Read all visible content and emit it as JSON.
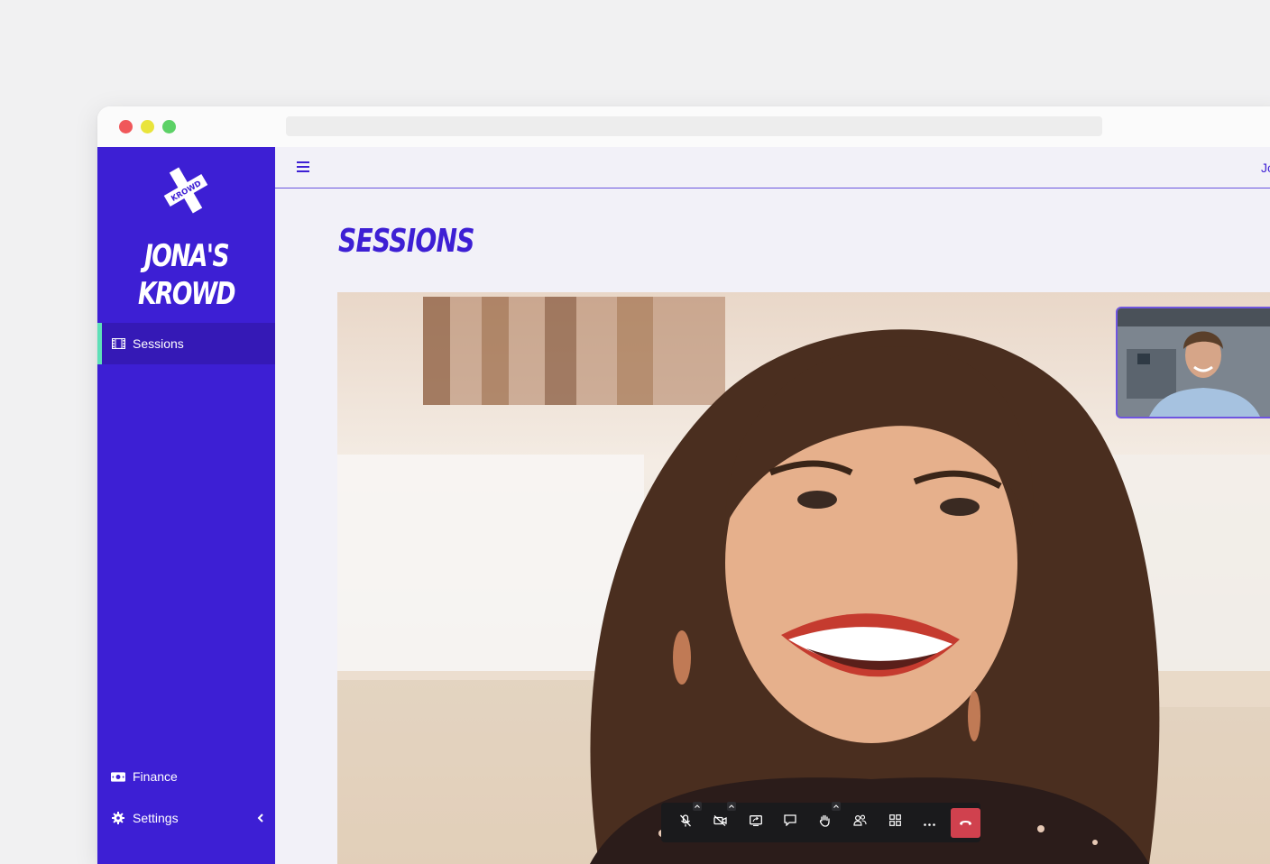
{
  "window": {
    "traffic_lights": [
      "close",
      "minimize",
      "maximize"
    ]
  },
  "sidebar": {
    "logo_text": "KROWD",
    "brand_line1": "JONA'S",
    "brand_line2": "KROWD",
    "items": [
      {
        "label": "Sessions",
        "icon": "film-icon",
        "active": true
      },
      {
        "label": "Finance",
        "icon": "money-icon",
        "active": false
      },
      {
        "label": "Settings",
        "icon": "gear-icon",
        "active": false
      }
    ],
    "collapse_icon": "chevron-left-icon",
    "accent_color": "#3d1fd4",
    "active_indicator_color": "#5fe0b8"
  },
  "topbar": {
    "menu_icon": "hamburger-icon",
    "user_initial": "Jo"
  },
  "main": {
    "title": "SESSIONS"
  },
  "call_controls": [
    {
      "name": "mute-mic",
      "icon": "mic-off-icon",
      "has_menu": true
    },
    {
      "name": "camera-off",
      "icon": "video-off-icon",
      "has_menu": true
    },
    {
      "name": "share-screen",
      "icon": "screen-share-icon",
      "has_menu": false
    },
    {
      "name": "chat",
      "icon": "chat-icon",
      "has_menu": false
    },
    {
      "name": "raise-hand",
      "icon": "hand-icon",
      "has_menu": true
    },
    {
      "name": "participants",
      "icon": "people-icon",
      "has_menu": false
    },
    {
      "name": "layout",
      "icon": "grid-icon",
      "has_menu": false
    },
    {
      "name": "more",
      "icon": "more-icon",
      "has_menu": false
    },
    {
      "name": "hang-up",
      "icon": "phone-hangup-icon",
      "color": "#d0414e"
    }
  ]
}
